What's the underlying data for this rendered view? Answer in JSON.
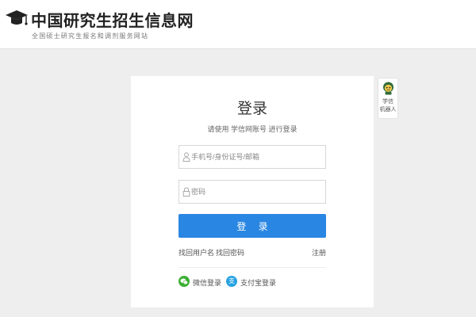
{
  "header": {
    "site_title": "中国研究生招生信息网",
    "site_subtitle": "全国硕士研究生报名和调剂服务网站",
    "logo_icon": "graduation-cap-icon"
  },
  "login": {
    "title": "登录",
    "subtitle": "请使用 学信网账号 进行登录",
    "username": {
      "placeholder": "手机号/身份证号/邮箱",
      "value": "",
      "icon": "user-icon"
    },
    "password": {
      "placeholder": "密码",
      "value": "",
      "icon": "lock-icon"
    },
    "submit_label": "登 录",
    "links": {
      "find_username": "找回用户名",
      "find_password": "找回密码",
      "register": "注册"
    },
    "social": {
      "wechat_label": "微信登录",
      "alipay_label": "支付宝登录",
      "alipay_glyph": "支"
    }
  },
  "robot": {
    "label_line1": "学信",
    "label_line2": "机器人",
    "icon": "robot-icon"
  },
  "colors": {
    "primary_button": "#2a86e3",
    "wechat": "#3cb034",
    "alipay": "#27a2e3",
    "page_background": "#eeeeee"
  }
}
